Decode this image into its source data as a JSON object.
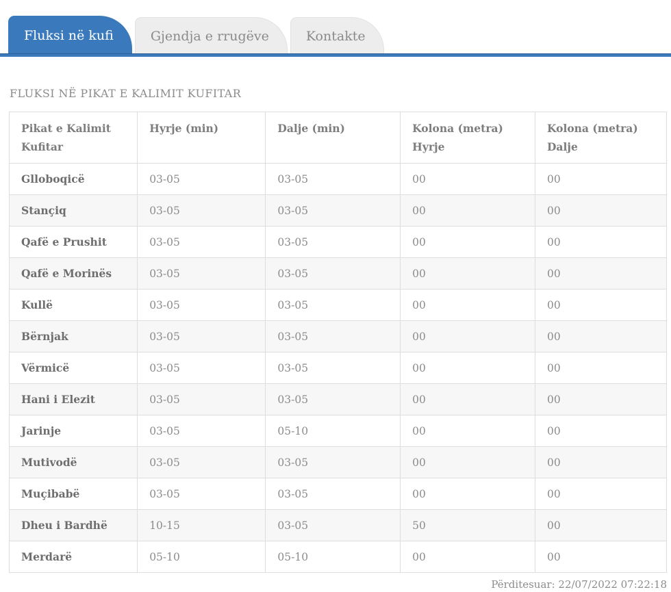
{
  "tabs": [
    {
      "label": "Fluksi në kufi",
      "active": true
    },
    {
      "label": "Gjendja e rrugëve",
      "active": false
    },
    {
      "label": "Kontakte",
      "active": false
    }
  ],
  "heading": "FLUKSI NË PIKAT E KALIMIT KUFITAR",
  "table": {
    "columns": [
      "Pikat e Kalimit Kufitar",
      "Hyrje (min)",
      "Dalje (min)",
      "Kolona (metra) Hyrje",
      "Kolona (metra) Dalje"
    ],
    "rows": [
      [
        "Glloboqicë",
        "03-05",
        "03-05",
        "00",
        "00"
      ],
      [
        "Stançiq",
        "03-05",
        "03-05",
        "00",
        "00"
      ],
      [
        "Qafë e Prushit",
        "03-05",
        "03-05",
        "00",
        "00"
      ],
      [
        "Qafë e Morinës",
        "03-05",
        "03-05",
        "00",
        "00"
      ],
      [
        "Kullë",
        "03-05",
        "03-05",
        "00",
        "00"
      ],
      [
        "Bërnjak",
        "03-05",
        "03-05",
        "00",
        "00"
      ],
      [
        "Vërmicë",
        "03-05",
        "03-05",
        "00",
        "00"
      ],
      [
        "Hani i Elezit",
        "03-05",
        "03-05",
        "00",
        "00"
      ],
      [
        "Jarinje",
        "03-05",
        "05-10",
        "00",
        "00"
      ],
      [
        "Mutivodë",
        "03-05",
        "03-05",
        "00",
        "00"
      ],
      [
        "Muçibabë",
        "03-05",
        "03-05",
        "00",
        "00"
      ],
      [
        "Dheu i Bardhë",
        "10-15",
        "03-05",
        "50",
        "00"
      ],
      [
        "Merdarë",
        "05-10",
        "05-10",
        "00",
        "00"
      ]
    ]
  },
  "footer": {
    "updated": "Përditesuar: 22/07/2022 07:22:18"
  },
  "colors": {
    "accent_blue": "#3a79bb",
    "underline_dark_blue": "#2b5f96",
    "inactive_tab_bg": "#ededed",
    "row_alt_bg": "#f7f7f7",
    "table_border": "#dddddd",
    "text_gray": "#8c8c8c"
  }
}
